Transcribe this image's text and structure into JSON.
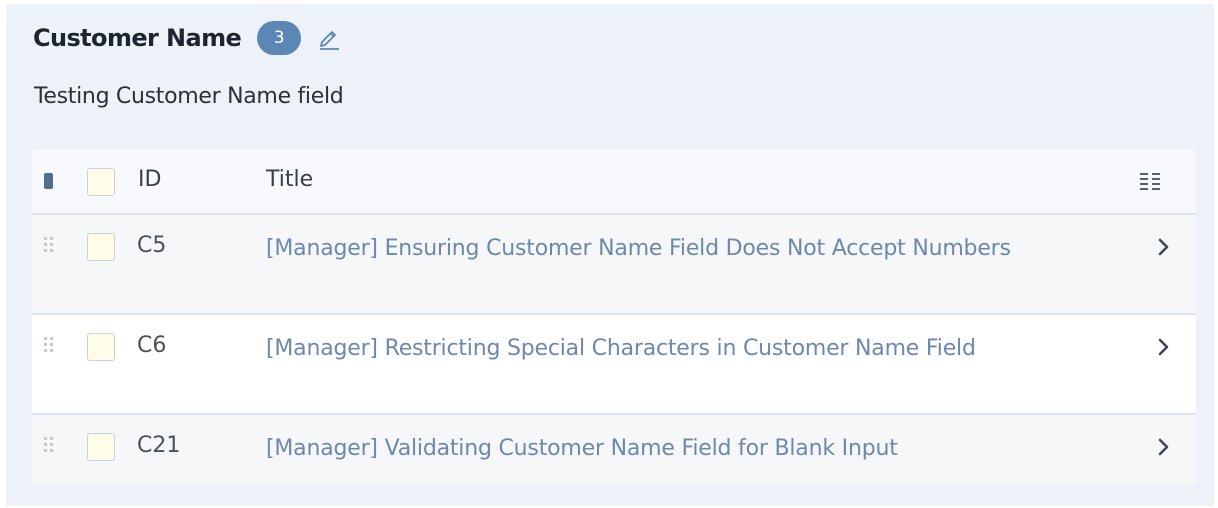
{
  "section": {
    "title": "Customer Name",
    "count": "3",
    "description": "Testing Customer Name field"
  },
  "table": {
    "columns": {
      "id": "ID",
      "title": "Title"
    },
    "rows": [
      {
        "id": "C5",
        "title": "[Manager] Ensuring Customer Name Field Does Not Accept Numbers"
      },
      {
        "id": "C6",
        "title": "[Manager] Restricting Special Characters in Customer Name Field"
      },
      {
        "id": "C21",
        "title": "[Manager] Validating Customer Name Field for Blank Input"
      }
    ]
  },
  "icons": {
    "edit": "pencil-icon",
    "column_settings": "column-settings-icon",
    "drag": "drag-handle-icon",
    "row_open": "chevron-right-icon"
  },
  "colors": {
    "background": "#edf1f8",
    "badge": "#5b86b5",
    "link": "#6d88ad",
    "checkbox_fill": "#fffce8"
  }
}
